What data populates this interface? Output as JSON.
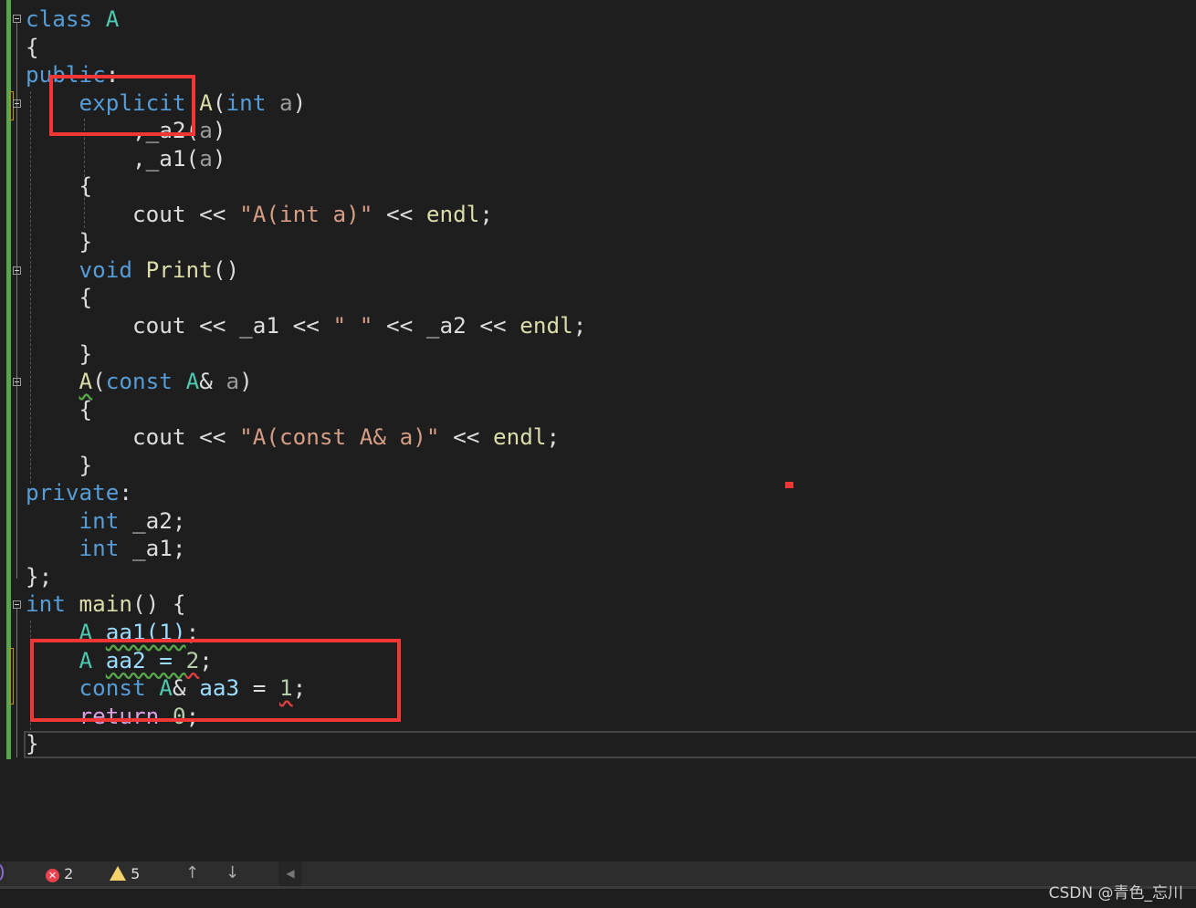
{
  "editor": {
    "lines": [
      [
        [
          "class",
          "kw"
        ],
        [
          " ",
          "tx"
        ],
        [
          "A",
          "ty"
        ]
      ],
      [
        [
          "{",
          "tx"
        ]
      ],
      [
        [
          "public",
          "kw"
        ],
        [
          ":",
          "tx"
        ]
      ],
      [
        [
          "    ",
          "tx"
        ],
        [
          "explicit",
          "kw"
        ],
        [
          " ",
          "tx"
        ],
        [
          "A",
          "fn"
        ],
        [
          "(",
          "tx"
        ],
        [
          "int",
          "kw"
        ],
        [
          " ",
          "tx"
        ],
        [
          "a",
          "pa"
        ],
        [
          ")",
          "tx"
        ]
      ],
      [
        [
          "        ,",
          "tx"
        ],
        [
          "_a2",
          "tx"
        ],
        [
          "(",
          "tx"
        ],
        [
          "a",
          "pa"
        ],
        [
          ")",
          "tx"
        ]
      ],
      [
        [
          "        ,",
          "tx"
        ],
        [
          "_a1",
          "tx"
        ],
        [
          "(",
          "tx"
        ],
        [
          "a",
          "pa"
        ],
        [
          ")",
          "tx"
        ]
      ],
      [
        [
          "    {",
          "tx"
        ]
      ],
      [
        [
          "        cout << ",
          "tx"
        ],
        [
          "\"A(int a)\"",
          "st"
        ],
        [
          " << ",
          "tx"
        ],
        [
          "endl",
          "fn"
        ],
        [
          ";",
          "tx"
        ]
      ],
      [
        [
          "    }",
          "tx"
        ]
      ],
      [
        [
          "    ",
          "tx"
        ],
        [
          "void",
          "kw"
        ],
        [
          " ",
          "tx"
        ],
        [
          "Print",
          "fn"
        ],
        [
          "()",
          "tx"
        ]
      ],
      [
        [
          "    {",
          "tx"
        ]
      ],
      [
        [
          "        cout << ",
          "tx"
        ],
        [
          "_a1",
          "tx"
        ],
        [
          " << ",
          "tx"
        ],
        [
          "\" \"",
          "st"
        ],
        [
          " << ",
          "tx"
        ],
        [
          "_a2",
          "tx"
        ],
        [
          " << ",
          "tx"
        ],
        [
          "endl",
          "fn"
        ],
        [
          ";",
          "tx"
        ]
      ],
      [
        [
          "    }",
          "tx"
        ]
      ],
      [
        [
          "    ",
          "tx"
        ],
        [
          "A",
          "fn wg"
        ],
        [
          "(",
          "tx"
        ],
        [
          "const",
          "kw"
        ],
        [
          " ",
          "tx"
        ],
        [
          "A",
          "ty"
        ],
        [
          "& ",
          "tx"
        ],
        [
          "a",
          "pa"
        ],
        [
          ")",
          "tx"
        ]
      ],
      [
        [
          "    {",
          "tx"
        ]
      ],
      [
        [
          "        cout << ",
          "tx"
        ],
        [
          "\"A(const A& a)\"",
          "st"
        ],
        [
          " << ",
          "tx"
        ],
        [
          "endl",
          "fn"
        ],
        [
          ";",
          "tx"
        ]
      ],
      [
        [
          "    }",
          "tx"
        ]
      ],
      [
        [
          "private",
          "kw"
        ],
        [
          ":",
          "tx"
        ]
      ],
      [
        [
          "    ",
          "tx"
        ],
        [
          "int",
          "kw"
        ],
        [
          " _a2;",
          "tx"
        ]
      ],
      [
        [
          "    ",
          "tx"
        ],
        [
          "int",
          "kw"
        ],
        [
          " _a1;",
          "tx"
        ]
      ],
      [
        [
          "};",
          "tx"
        ]
      ],
      [
        [
          "int",
          "kw"
        ],
        [
          " ",
          "tx"
        ],
        [
          "main",
          "fn"
        ],
        [
          "() {",
          "tx"
        ]
      ],
      [
        [
          "    ",
          "tx"
        ],
        [
          "A",
          "ty"
        ],
        [
          " ",
          "tx"
        ],
        [
          "aa1(1)",
          "va wg"
        ],
        [
          ";",
          "tx"
        ]
      ],
      [
        [
          "    ",
          "tx"
        ],
        [
          "A",
          "ty"
        ],
        [
          " ",
          "tx"
        ],
        [
          "aa2 = ",
          "va wg"
        ],
        [
          "2",
          "nu wr"
        ],
        [
          ";",
          "tx"
        ]
      ],
      [
        [
          "    ",
          "tx"
        ],
        [
          "const",
          "kw"
        ],
        [
          " ",
          "tx"
        ],
        [
          "A",
          "ty"
        ],
        [
          "& ",
          "tx"
        ],
        [
          "aa3",
          "va"
        ],
        [
          " = ",
          "tx"
        ],
        [
          "1",
          "nu wr"
        ],
        [
          ";",
          "tx"
        ]
      ],
      [
        [
          "    ",
          "tx"
        ],
        [
          "return",
          "rt"
        ],
        [
          " ",
          "tx"
        ],
        [
          "0",
          "nu"
        ],
        [
          ";",
          "tx"
        ]
      ],
      [
        [
          "}",
          "tx"
        ]
      ]
    ]
  },
  "statusbar": {
    "error_count": "2",
    "warning_count": "5",
    "up_arrow": "↑",
    "down_arrow": "↓",
    "scroll_left": "◀"
  },
  "watermark": "CSDN @青色_忘川",
  "colors": {
    "keyword": "#569cd6",
    "type": "#4ec9b0",
    "function": "#dcdcaa",
    "string": "#d69d85",
    "highlight_box": "#f23535"
  }
}
